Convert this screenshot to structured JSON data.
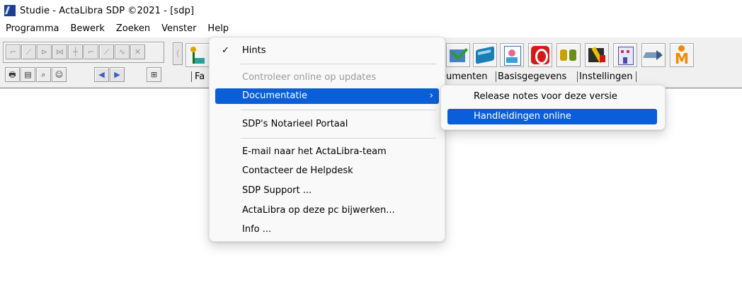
{
  "window": {
    "title": "Studie - ActaLibra  SDP ©2021 - [sdp]",
    "app_icon": "actalibra-feather-icon"
  },
  "menubar": {
    "items": [
      "Programma",
      "Bewerk",
      "Zoeken",
      "Venster",
      "Help"
    ]
  },
  "tabs": {
    "items": [
      "Fa",
      "umenten",
      "Basisgegevens",
      "Instellingen"
    ]
  },
  "help_menu": {
    "hints": "Hints",
    "check_updates": "Controleer online op updates",
    "documentation": "Documentatie",
    "notarial_portal": "SDP's Notarieel Portaal",
    "email_team": "E-mail naar het ActaLibra-team",
    "contact_helpdesk": "Contacteer de Helpdesk",
    "sdp_support": "SDP Support ...",
    "update_pc": "ActaLibra op deze pc bijwerken...",
    "info": "Info ...",
    "checkmark": "✓",
    "submenu_arrow": "›"
  },
  "documentation_submenu": {
    "release_notes": "Release notes voor deze versie",
    "manuals_online": "Handleidingen online"
  },
  "colors": {
    "selection": "#0a5ed7",
    "menu_bg": "#f9f9f9",
    "disabled_text": "#9a9a9a"
  }
}
